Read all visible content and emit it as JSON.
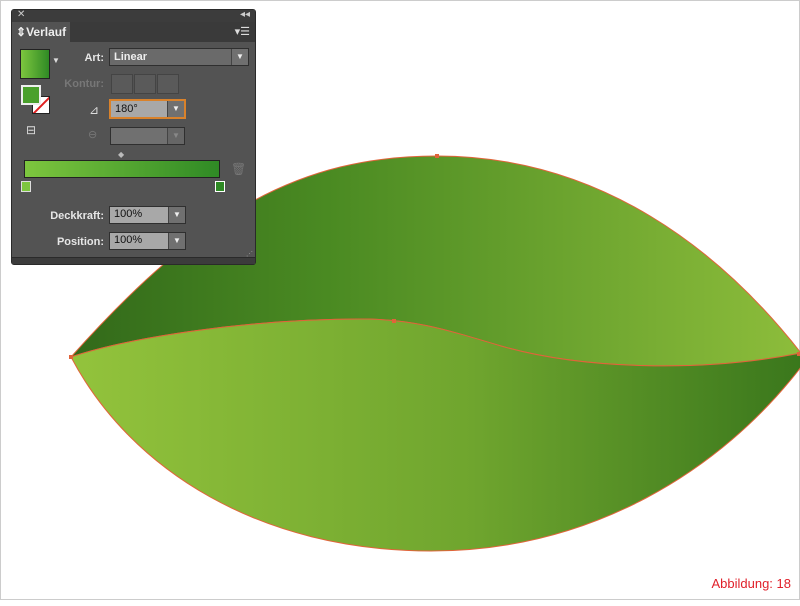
{
  "panel": {
    "title": "Verlauf",
    "art_label": "Art:",
    "art_value": "Linear",
    "kontur_label": "Kontur:",
    "angle_value": "180°",
    "deckkraft_label": "Deckkraft:",
    "deckkraft_value": "100%",
    "position_label": "Position:",
    "position_value": "100%",
    "gradient_colors": [
      "#7dc63e",
      "#2f8a25"
    ]
  },
  "artwork": {
    "upper_leaf_colors": [
      "#3e7a1e",
      "#8dbd3b"
    ],
    "lower_leaf_colors": [
      "#93c33c",
      "#3b7a1c"
    ],
    "path_color": "#e0643a"
  },
  "caption": "Abbildung: 18"
}
